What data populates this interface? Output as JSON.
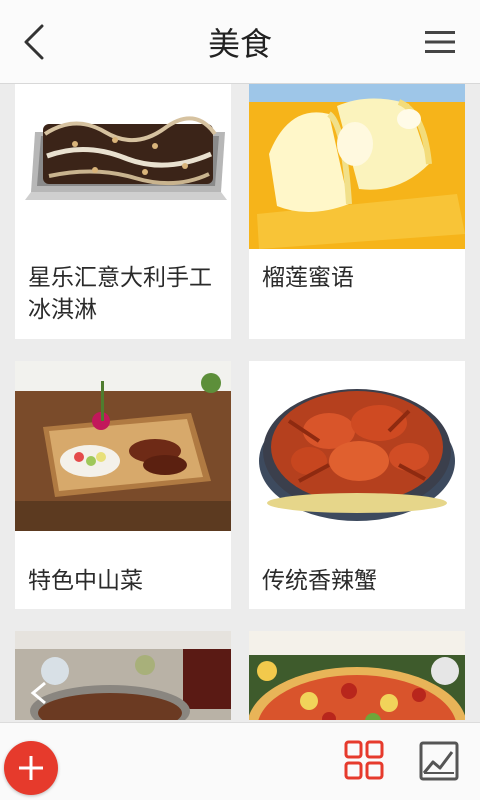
{
  "header": {
    "title": "美食",
    "back_icon": "chevron-left-icon",
    "menu_icon": "hamburger-menu-icon"
  },
  "items": [
    {
      "name": "星乐汇意大利手工冰淇淋",
      "image": "chocolate-gelato-tray"
    },
    {
      "name": "榴莲蜜语",
      "image": "durian-crepe-cakes"
    },
    {
      "name": "特色中山菜",
      "image": "roast-pigeon-platter"
    },
    {
      "name": "传统香辣蟹",
      "image": "spicy-crab-platter"
    },
    {
      "name": "",
      "image": "buffet-dish-partial"
    },
    {
      "name": "",
      "image": "pizza-partial"
    }
  ],
  "toolbar": {
    "add_icon": "plus-icon",
    "grid_icon": "grid-view-icon",
    "gallery_icon": "image-gallery-icon",
    "accent_color": "#e63a2c"
  }
}
